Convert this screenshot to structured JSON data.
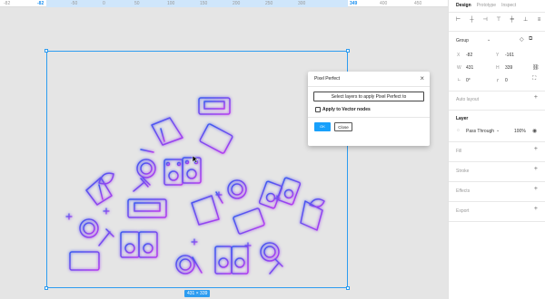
{
  "ruler": {
    "ticks": [
      "-82",
      "-50",
      "0",
      "50",
      "100",
      "150",
      "200",
      "250",
      "300",
      "349",
      "400",
      "450"
    ]
  },
  "canvas": {
    "size_badge": "431 × 339"
  },
  "dialog": {
    "title": "Pixel Perfect",
    "close_icon": "×",
    "select_button": "Select layers to apply Pixel Perfect to",
    "checkbox_label": "Apply to Vector nodes",
    "ok_button": "OK",
    "close_button": "Close"
  },
  "panel": {
    "tabs": [
      "Design",
      "Prototype",
      "Inspect"
    ],
    "group_label": "Group",
    "x_label": "X",
    "x_value": "-82",
    "y_label": "Y",
    "y_value": "-161",
    "w_label": "W",
    "w_value": "431",
    "h_label": "H",
    "h_value": "339",
    "rotation_value": "0°",
    "radius_value": "0",
    "auto_layout": "Auto layout",
    "layer_label": "Layer",
    "blend_mode": "Pass Through",
    "opacity": "100%",
    "fill": "Fill",
    "stroke": "Stroke",
    "effects": "Effects",
    "export": "Export"
  },
  "colors": {
    "accent": "#18a0fb",
    "icon_gradient_start": "#3d5bf0",
    "icon_gradient_end": "#b43cf0"
  }
}
